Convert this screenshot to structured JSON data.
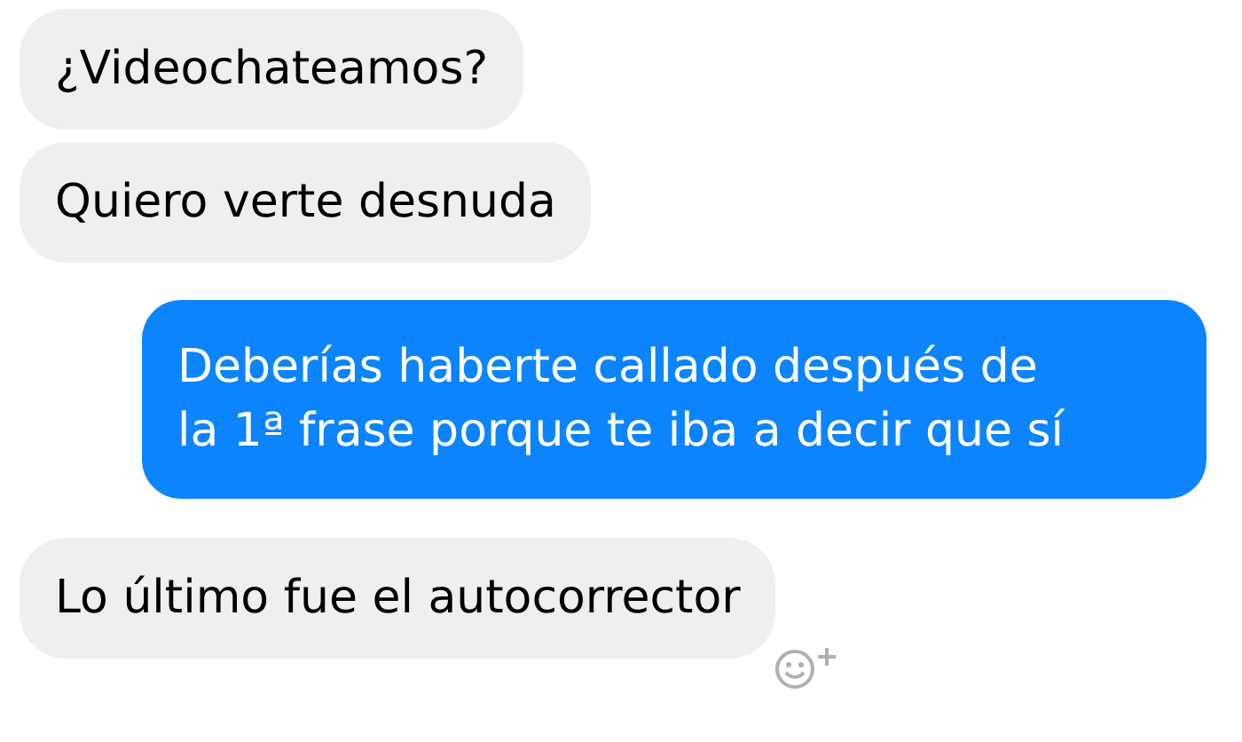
{
  "messages": [
    {
      "kind": "received",
      "text": "¿Videochateamos?"
    },
    {
      "kind": "received",
      "text": "Quiero verte desnuda"
    },
    {
      "kind": "sent",
      "text": "Deberías haberte callado después de la 1ª frase porque te iba a decir que sí"
    },
    {
      "kind": "received",
      "text": "Lo último fue el autocorrector",
      "reaction_button": true
    }
  ]
}
